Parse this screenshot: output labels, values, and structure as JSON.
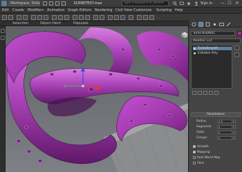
{
  "titlebar": {
    "workspace_label": "Workspace: Default",
    "file_title": "SCENETEST.max",
    "search_placeholder": "Type a keyword or phrase",
    "signin_label": "Sign In",
    "minimize_glyph": "—",
    "maximize_glyph": "☐",
    "close_glyph": "✕"
  },
  "menus": [
    "Edit",
    "Create",
    "Modifiers",
    "Animation",
    "Graph Editors",
    "Rendering",
    "Civil View",
    "Customize",
    "Scripting",
    "Help"
  ],
  "subtabs": [
    "Selection",
    "Object Paint",
    "Populate"
  ],
  "command_panel": {
    "object_name": "Torus Knot001",
    "object_color": "#b0259e",
    "modifier_list_label": "Modifier List",
    "stack_items": [
      "TurboSmooth",
      "Editable Poly"
    ],
    "rollout_title": "Parameters",
    "params": [
      {
        "label": "Radius",
        "value": "0.0"
      },
      {
        "label": "Segments",
        "value": "0"
      },
      {
        "label": "Sides",
        "value": "0"
      },
      {
        "label": "Groups",
        "value": "0"
      }
    ],
    "options": [
      {
        "label": "Smooth",
        "checked": true
      },
      {
        "label": "Mapping",
        "checked": true
      },
      {
        "label": "Real-World Map",
        "checked": false
      },
      {
        "label": "Slice",
        "checked": false
      }
    ]
  },
  "viewport": {
    "object_color": "#a43bb0",
    "floor_color": "#8a8c8e",
    "background_color": "#6b6e72"
  }
}
